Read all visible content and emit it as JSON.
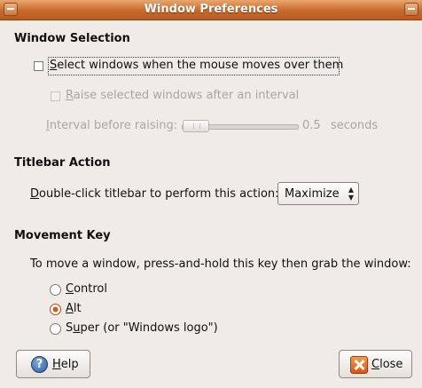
{
  "window": {
    "title": "Window Preferences"
  },
  "window_selection": {
    "heading": "Window Selection",
    "select_on_hover": {
      "mnemonic": "S",
      "rest": "elect windows when the mouse moves over them",
      "checked": false
    },
    "raise_after_interval": {
      "mnemonic": "R",
      "rest": "aise selected windows after an interval",
      "checked": false,
      "enabled": false
    },
    "interval": {
      "mnemonic": "I",
      "rest": "nterval before raising:",
      "value": "0.5",
      "unit": "seconds",
      "slider_fraction": 0.05,
      "enabled": false
    }
  },
  "titlebar_action": {
    "heading": "Titlebar Action",
    "label_mnemonic": "D",
    "label_rest": "ouble-click titlebar to perform this action:",
    "selected": "Maximize"
  },
  "movement_key": {
    "heading": "Movement Key",
    "instructions": "To move a window, press-and-hold this key then grab the window:",
    "options": [
      {
        "mnemonic": "C",
        "rest": "ontrol",
        "selected": false
      },
      {
        "mnemonic": "A",
        "rest": "lt",
        "selected": true
      },
      {
        "pre": "S",
        "mnemonic": "u",
        "rest": "per (or \"Windows logo\")",
        "selected": false
      }
    ]
  },
  "buttons": {
    "help": {
      "mnemonic": "H",
      "rest": "elp"
    },
    "close": {
      "mnemonic": "C",
      "rest": "lose"
    }
  },
  "colors": {
    "titlebar": "#c8692c",
    "background": "#efebe7",
    "accent": "#d0581f"
  }
}
